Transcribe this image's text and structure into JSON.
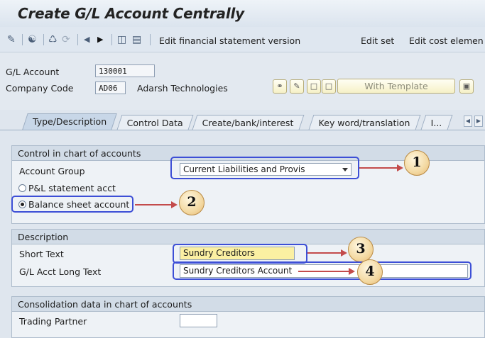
{
  "window": {
    "title": "Create G/L Account Centrally"
  },
  "toolbar": {
    "icons": [
      "change-display-icon",
      "switch-icon",
      "flip-icon",
      "arrows-icon",
      "prev-icon",
      "next-icon",
      "overview-icon",
      "document-icon"
    ],
    "buttons": [
      "Edit financial statement version",
      "Edit set",
      "Edit cost elemen"
    ]
  },
  "header": {
    "gl_account_label": "G/L Account",
    "gl_account_value": "130001",
    "company_code_label": "Company Code",
    "company_code_value": "AD06",
    "company_name": "Adarsh Technologies",
    "with_template_label": "With Template"
  },
  "tabs": [
    {
      "label": "Type/Description",
      "active": true
    },
    {
      "label": "Control Data",
      "active": false
    },
    {
      "label": "Create/bank/interest",
      "active": false
    },
    {
      "label": "Key word/translation",
      "active": false
    },
    {
      "label": "I...",
      "active": false
    }
  ],
  "control_group": {
    "heading": "Control in chart of accounts",
    "account_group_label": "Account Group",
    "account_group_value": "Current Liabilities and Provis",
    "pl_label": "P&L statement acct",
    "balance_label": "Balance sheet account",
    "selected": "balance"
  },
  "description_group": {
    "heading": "Description",
    "short_text_label": "Short Text",
    "short_text_value": "Sundry Creditors",
    "long_text_label": "G/L Acct Long Text",
    "long_text_value": "Sundry Creditors Account"
  },
  "consolidation_group": {
    "heading": "Consolidation data in chart of accounts",
    "trading_partner_label": "Trading Partner",
    "trading_partner_value": ""
  },
  "annotations": {
    "markers": [
      "1",
      "2",
      "3",
      "4"
    ],
    "highlight_color": "#3d4fd6",
    "arrow_color": "#c34b4b"
  }
}
